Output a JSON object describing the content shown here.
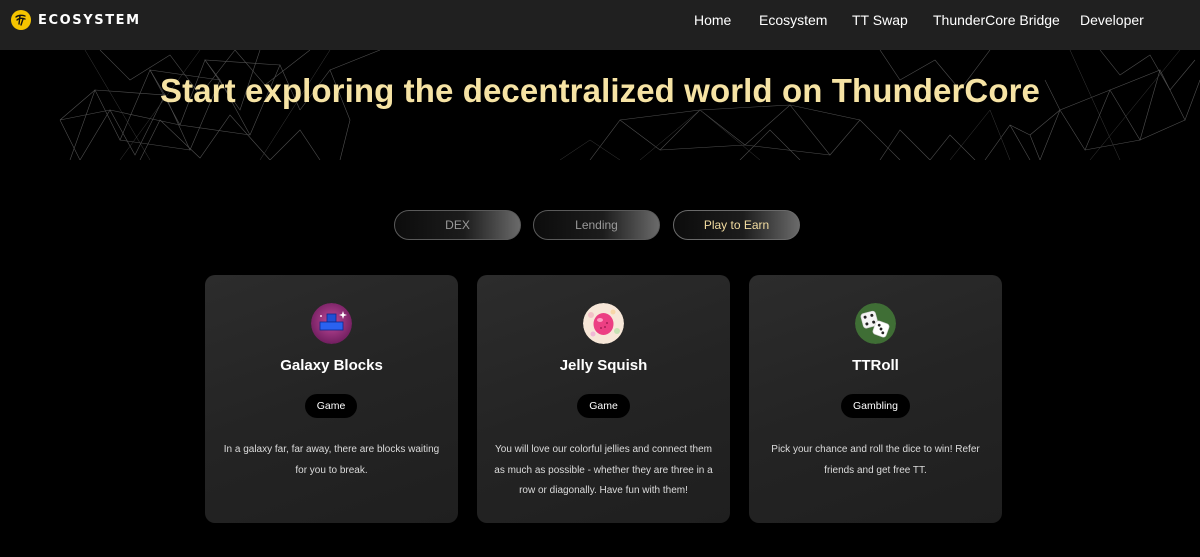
{
  "nav": {
    "brand": "Ecosystem",
    "links": [
      "Home",
      "Ecosystem",
      "TT Swap",
      "ThunderCore Bridge",
      "Developer"
    ]
  },
  "hero": {
    "title": "Start exploring the decentralized world on ThunderCore"
  },
  "tabs": [
    {
      "label": "DEX",
      "active": false
    },
    {
      "label": "Lending",
      "active": false
    },
    {
      "label": "Play to Earn",
      "active": true
    }
  ],
  "cards": [
    {
      "icon": "galaxy-blocks-icon",
      "title": "Galaxy Blocks",
      "tag": "Game",
      "description": "In a galaxy far, far away, there are blocks waiting for you to break."
    },
    {
      "icon": "jelly-squish-icon",
      "title": "Jelly Squish",
      "tag": "Game",
      "description": "You will love our colorful jellies and connect them as much as possible - whether they are three in a row or diagonally. Have fun with them!"
    },
    {
      "icon": "dice-icon",
      "title": "TTRoll",
      "tag": "Gambling",
      "description": "Pick your chance and roll the dice to win! Refer friends and get free TT."
    }
  ],
  "colors": {
    "accent": "#f6e3a4",
    "brand_yellow": "#f5c400",
    "nav_bg": "#202020",
    "card_bg": "#2a2a2a"
  }
}
